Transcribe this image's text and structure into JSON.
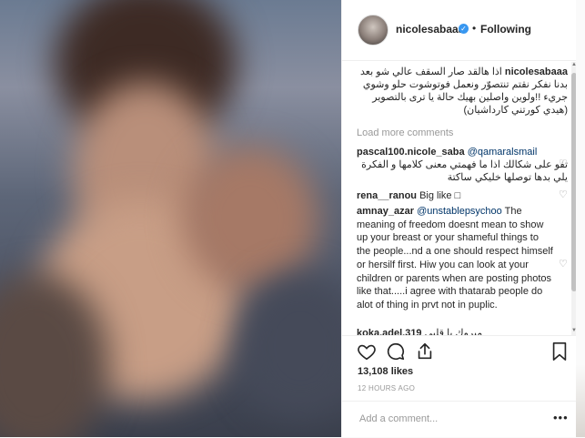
{
  "post": {
    "username": "nicolesabaaa",
    "follow_status": "Following",
    "dot": "•",
    "verified_glyph": "✓"
  },
  "caption": {
    "username": "nicolesabaaa",
    "text": "اذا هالقد صار السقف عالي شو بعد بدنا‏ نفكر نقتم تنتصوّر ونعمل فوتوشوت حلو وشوي جريء‏ !!ولوين واصلين بهيك حالة يا ترى بالتصوير (هيدي كورتني كارداشيان)"
  },
  "load_more": "Load more comments",
  "comments": [
    {
      "username": "pascal100.nicole_saba",
      "mention": "@qamaralsmail",
      "text": "تفو على شكالك اذا ما فهمتي معنى كلامها و الفكرة يلي بدها توصلها خليكي ساكتة"
    },
    {
      "username": "rena__ranou",
      "text": "Big like □"
    },
    {
      "username": "amnay_azar",
      "mention": "@unstablepsychoo",
      "text": "The meaning of freedom doesnt mean to show up your breast or your shameful things to the people...nd a one should respect himself or hersilf first. Hiw you can look at your children or parents when are posting photos like that.....i agree with thatarab people do alot of thing in prvt not in puplic."
    },
    {
      "username": "koka.adel.319",
      "text": "مبروك يا قلبي"
    }
  ],
  "likes": "13,108 likes",
  "time": "12 HOURS AGO",
  "comment_placeholder": "Add a comment...",
  "icons": {
    "heart": "♡",
    "more": "•••",
    "scroll_up": "▲",
    "scroll_down": "▼"
  },
  "colors": {
    "accent_blue": "#3897f0",
    "mention": "#003569",
    "text": "#262626",
    "muted": "#999999"
  }
}
